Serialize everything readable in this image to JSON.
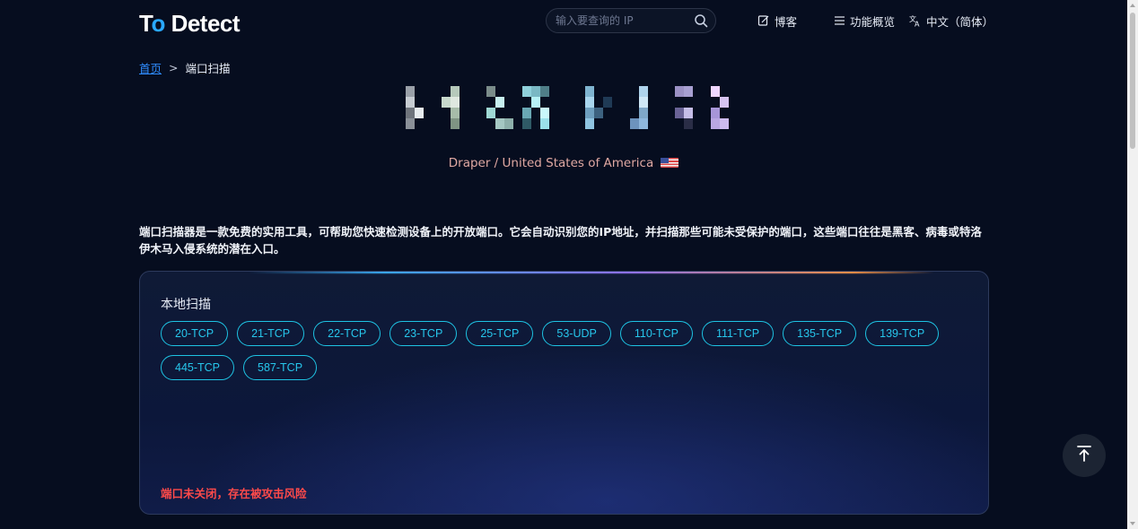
{
  "header": {
    "logo": {
      "part1": "T",
      "accent": "o",
      "part2": " Detect"
    },
    "search": {
      "placeholder": "输入要查询的 IP",
      "value": ""
    },
    "nav": {
      "blog_label": "博客",
      "features_label": "功能概览",
      "language_label": "中文（简体）"
    }
  },
  "breadcrumb": {
    "home": "首页",
    "separator": ">",
    "current": "端口扫描"
  },
  "ip_display": {
    "state": "pixelated"
  },
  "location": {
    "text": "Draper / United States of America",
    "flag": "us-flag-icon"
  },
  "description": "端口扫描器是一款免费的实用工具，可帮助您快速检测设备上的开放端口。它会自动识别您的IP地址，并扫描那些可能未受保护的端口，这些端口往往是黑客、病毒或特洛伊木马入侵系统的潜在入口。",
  "scan": {
    "title": "本地扫描",
    "ports": [
      {
        "label": "20-TCP"
      },
      {
        "label": "21-TCP"
      },
      {
        "label": "22-TCP"
      },
      {
        "label": "23-TCP"
      },
      {
        "label": "25-TCP"
      },
      {
        "label": "53-UDP"
      },
      {
        "label": "110-TCP"
      },
      {
        "label": "111-TCP"
      },
      {
        "label": "135-TCP"
      },
      {
        "label": "139-TCP"
      },
      {
        "label": "445-TCP"
      },
      {
        "label": "587-TCP"
      }
    ],
    "warning": "端口未关闭，存在被攻击风险"
  },
  "colors": {
    "background": "#060d1f",
    "accent": "#27c7ec",
    "link": "#2f8cff",
    "warning": "#ff4a4a",
    "location": "#e0a8a2"
  }
}
